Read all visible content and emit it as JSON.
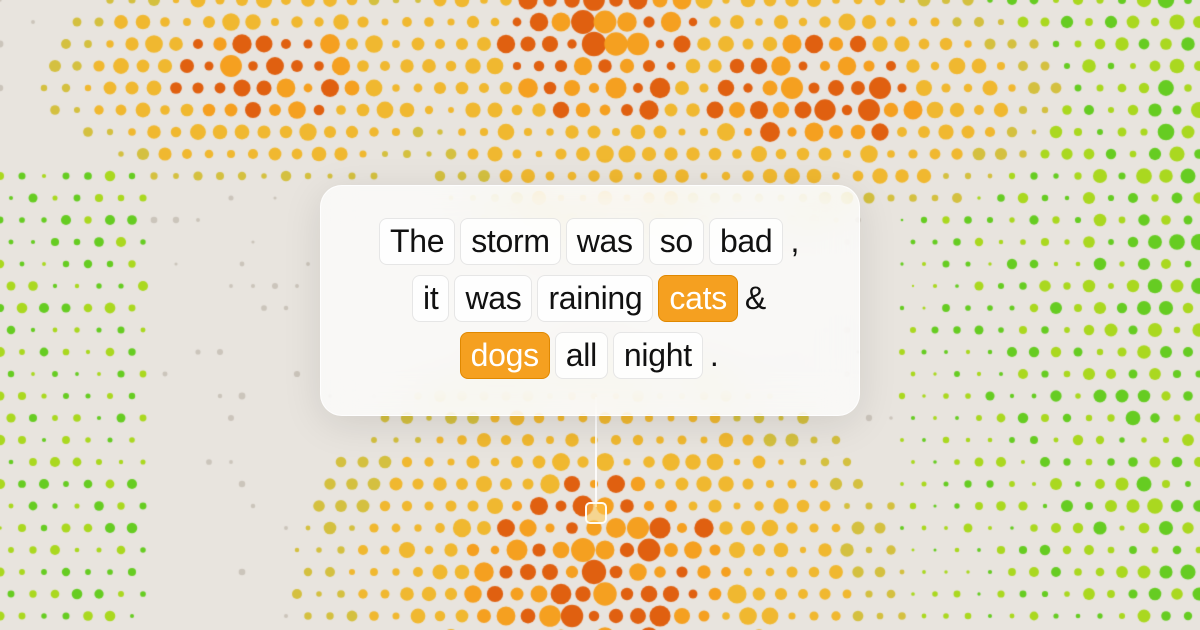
{
  "background": {
    "colors": {
      "base": "#e8e4de",
      "orange": "#f5a020",
      "orange_dark": "#e06000",
      "yellow": "#d4c400",
      "yellow_green": "#aacc00",
      "green": "#44cc44",
      "lime": "#88dd00"
    }
  },
  "popup": {
    "lines": [
      [
        {
          "text": "The",
          "type": "normal"
        },
        {
          "text": "storm",
          "type": "normal"
        },
        {
          "text": "was",
          "type": "normal"
        },
        {
          "text": "so",
          "type": "normal"
        },
        {
          "text": "bad",
          "type": "normal"
        },
        {
          "text": ",",
          "type": "punct"
        }
      ],
      [
        {
          "text": "it",
          "type": "normal"
        },
        {
          "text": "was",
          "type": "normal"
        },
        {
          "text": "raining",
          "type": "normal"
        },
        {
          "text": "cats",
          "type": "highlight"
        },
        {
          "text": "&",
          "type": "punct"
        }
      ],
      [
        {
          "text": "dogs",
          "type": "highlight"
        },
        {
          "text": "all",
          "type": "normal"
        },
        {
          "text": "night",
          "type": "normal"
        },
        {
          "text": ".",
          "type": "punct"
        }
      ]
    ]
  }
}
